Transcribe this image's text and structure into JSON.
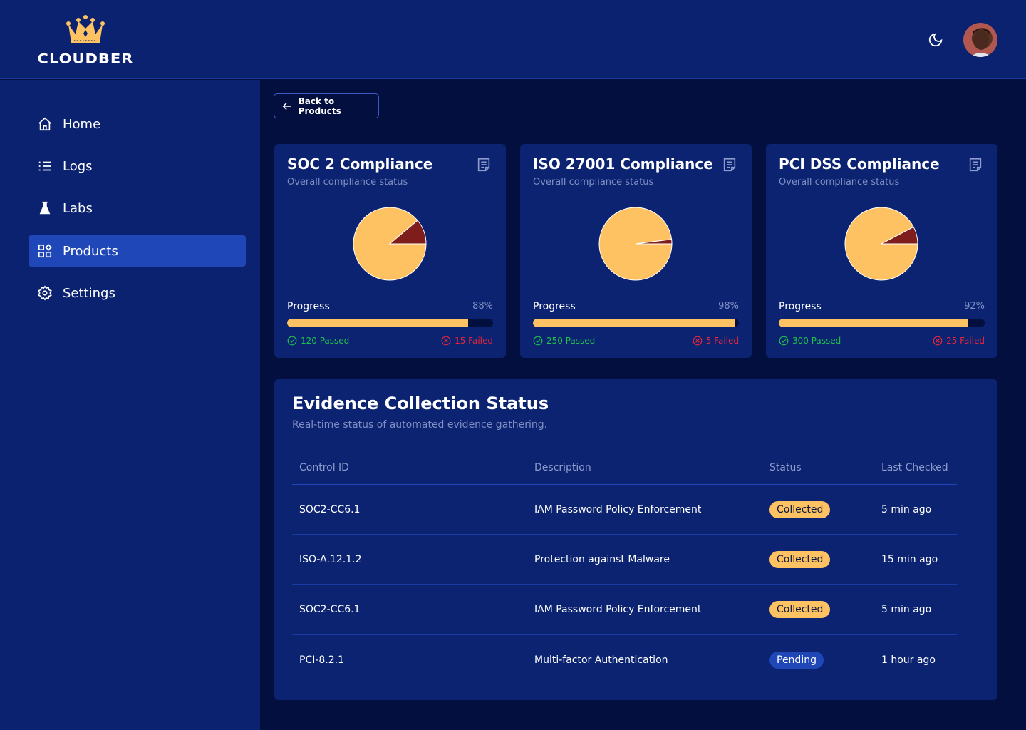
{
  "brand": {
    "name": "CLOUDBER",
    "logo_icon": "crown-icon",
    "accent": "#fec263"
  },
  "header": {
    "theme_icon": "moon-icon",
    "avatar_icon": "user-avatar"
  },
  "sidebar": {
    "items": [
      {
        "label": "Home",
        "icon": "home-icon",
        "active": false
      },
      {
        "label": "Logs",
        "icon": "list-icon",
        "active": false
      },
      {
        "label": "Labs",
        "icon": "flask-icon",
        "active": false
      },
      {
        "label": "Products",
        "icon": "grid-icon",
        "active": true
      },
      {
        "label": "Settings",
        "icon": "gear-icon",
        "active": false
      }
    ]
  },
  "back_button": {
    "label": "Back to Products",
    "icon": "arrow-left-icon"
  },
  "cards": [
    {
      "title": "SOC 2 Compliance",
      "subtitle": "Overall compliance status",
      "progress_label": "Progress",
      "progress": "88%",
      "progress_value": 88,
      "passed": 120,
      "failed": 15,
      "passed_label": "120 Passed",
      "failed_label": "15 Failed"
    },
    {
      "title": "ISO 27001 Compliance",
      "subtitle": "Overall compliance status",
      "progress_label": "Progress",
      "progress": "98%",
      "progress_value": 98,
      "passed": 250,
      "failed": 5,
      "passed_label": "250 Passed",
      "failed_label": "5 Failed"
    },
    {
      "title": "PCI DSS Compliance",
      "subtitle": "Overall compliance status",
      "progress_label": "Progress",
      "progress": "92%",
      "progress_value": 92,
      "passed": 300,
      "failed": 25,
      "passed_label": "300 Passed",
      "failed_label": "25 Failed"
    }
  ],
  "colors": {
    "passed": "#fec263",
    "failed": "#7f1d1d",
    "passed_text": "#1fc24a",
    "failed_text": "#e8263a"
  },
  "evidence": {
    "title": "Evidence Collection Status",
    "subtitle": "Real-time status of automated evidence gathering.",
    "columns": [
      "Control ID",
      "Description",
      "Status",
      "Last Checked"
    ],
    "rows": [
      {
        "id": "SOC2-CC6.1",
        "description": "IAM Password Policy Enforcement",
        "status": "Collected",
        "last_checked": "5 min ago"
      },
      {
        "id": "ISO-A.12.1.2",
        "description": "Protection against Malware",
        "status": "Collected",
        "last_checked": "15 min ago"
      },
      {
        "id": "SOC2-CC6.1",
        "description": "IAM Password Policy Enforcement",
        "status": "Collected",
        "last_checked": "5 min ago"
      },
      {
        "id": "PCI-8.2.1",
        "description": "Multi-factor Authentication",
        "status": "Pending",
        "last_checked": "1 hour ago"
      }
    ]
  }
}
